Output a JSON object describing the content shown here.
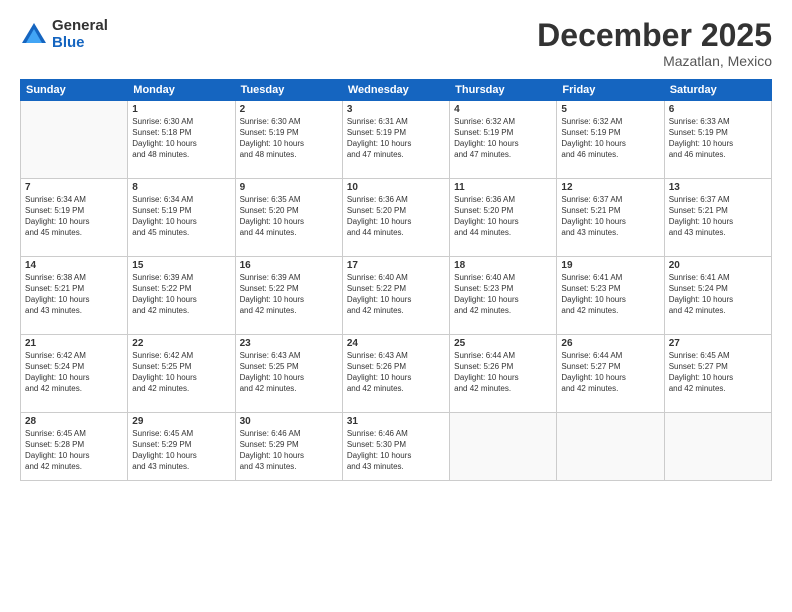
{
  "logo": {
    "general": "General",
    "blue": "Blue"
  },
  "title": "December 2025",
  "subtitle": "Mazatlan, Mexico",
  "headers": [
    "Sunday",
    "Monday",
    "Tuesday",
    "Wednesday",
    "Thursday",
    "Friday",
    "Saturday"
  ],
  "weeks": [
    [
      {
        "num": "",
        "info": ""
      },
      {
        "num": "1",
        "info": "Sunrise: 6:30 AM\nSunset: 5:18 PM\nDaylight: 10 hours\nand 48 minutes."
      },
      {
        "num": "2",
        "info": "Sunrise: 6:30 AM\nSunset: 5:19 PM\nDaylight: 10 hours\nand 48 minutes."
      },
      {
        "num": "3",
        "info": "Sunrise: 6:31 AM\nSunset: 5:19 PM\nDaylight: 10 hours\nand 47 minutes."
      },
      {
        "num": "4",
        "info": "Sunrise: 6:32 AM\nSunset: 5:19 PM\nDaylight: 10 hours\nand 47 minutes."
      },
      {
        "num": "5",
        "info": "Sunrise: 6:32 AM\nSunset: 5:19 PM\nDaylight: 10 hours\nand 46 minutes."
      },
      {
        "num": "6",
        "info": "Sunrise: 6:33 AM\nSunset: 5:19 PM\nDaylight: 10 hours\nand 46 minutes."
      }
    ],
    [
      {
        "num": "7",
        "info": "Sunrise: 6:34 AM\nSunset: 5:19 PM\nDaylight: 10 hours\nand 45 minutes."
      },
      {
        "num": "8",
        "info": "Sunrise: 6:34 AM\nSunset: 5:19 PM\nDaylight: 10 hours\nand 45 minutes."
      },
      {
        "num": "9",
        "info": "Sunrise: 6:35 AM\nSunset: 5:20 PM\nDaylight: 10 hours\nand 44 minutes."
      },
      {
        "num": "10",
        "info": "Sunrise: 6:36 AM\nSunset: 5:20 PM\nDaylight: 10 hours\nand 44 minutes."
      },
      {
        "num": "11",
        "info": "Sunrise: 6:36 AM\nSunset: 5:20 PM\nDaylight: 10 hours\nand 44 minutes."
      },
      {
        "num": "12",
        "info": "Sunrise: 6:37 AM\nSunset: 5:21 PM\nDaylight: 10 hours\nand 43 minutes."
      },
      {
        "num": "13",
        "info": "Sunrise: 6:37 AM\nSunset: 5:21 PM\nDaylight: 10 hours\nand 43 minutes."
      }
    ],
    [
      {
        "num": "14",
        "info": "Sunrise: 6:38 AM\nSunset: 5:21 PM\nDaylight: 10 hours\nand 43 minutes."
      },
      {
        "num": "15",
        "info": "Sunrise: 6:39 AM\nSunset: 5:22 PM\nDaylight: 10 hours\nand 42 minutes."
      },
      {
        "num": "16",
        "info": "Sunrise: 6:39 AM\nSunset: 5:22 PM\nDaylight: 10 hours\nand 42 minutes."
      },
      {
        "num": "17",
        "info": "Sunrise: 6:40 AM\nSunset: 5:22 PM\nDaylight: 10 hours\nand 42 minutes."
      },
      {
        "num": "18",
        "info": "Sunrise: 6:40 AM\nSunset: 5:23 PM\nDaylight: 10 hours\nand 42 minutes."
      },
      {
        "num": "19",
        "info": "Sunrise: 6:41 AM\nSunset: 5:23 PM\nDaylight: 10 hours\nand 42 minutes."
      },
      {
        "num": "20",
        "info": "Sunrise: 6:41 AM\nSunset: 5:24 PM\nDaylight: 10 hours\nand 42 minutes."
      }
    ],
    [
      {
        "num": "21",
        "info": "Sunrise: 6:42 AM\nSunset: 5:24 PM\nDaylight: 10 hours\nand 42 minutes."
      },
      {
        "num": "22",
        "info": "Sunrise: 6:42 AM\nSunset: 5:25 PM\nDaylight: 10 hours\nand 42 minutes."
      },
      {
        "num": "23",
        "info": "Sunrise: 6:43 AM\nSunset: 5:25 PM\nDaylight: 10 hours\nand 42 minutes."
      },
      {
        "num": "24",
        "info": "Sunrise: 6:43 AM\nSunset: 5:26 PM\nDaylight: 10 hours\nand 42 minutes."
      },
      {
        "num": "25",
        "info": "Sunrise: 6:44 AM\nSunset: 5:26 PM\nDaylight: 10 hours\nand 42 minutes."
      },
      {
        "num": "26",
        "info": "Sunrise: 6:44 AM\nSunset: 5:27 PM\nDaylight: 10 hours\nand 42 minutes."
      },
      {
        "num": "27",
        "info": "Sunrise: 6:45 AM\nSunset: 5:27 PM\nDaylight: 10 hours\nand 42 minutes."
      }
    ],
    [
      {
        "num": "28",
        "info": "Sunrise: 6:45 AM\nSunset: 5:28 PM\nDaylight: 10 hours\nand 42 minutes."
      },
      {
        "num": "29",
        "info": "Sunrise: 6:45 AM\nSunset: 5:29 PM\nDaylight: 10 hours\nand 43 minutes."
      },
      {
        "num": "30",
        "info": "Sunrise: 6:46 AM\nSunset: 5:29 PM\nDaylight: 10 hours\nand 43 minutes."
      },
      {
        "num": "31",
        "info": "Sunrise: 6:46 AM\nSunset: 5:30 PM\nDaylight: 10 hours\nand 43 minutes."
      },
      {
        "num": "",
        "info": ""
      },
      {
        "num": "",
        "info": ""
      },
      {
        "num": "",
        "info": ""
      }
    ]
  ]
}
